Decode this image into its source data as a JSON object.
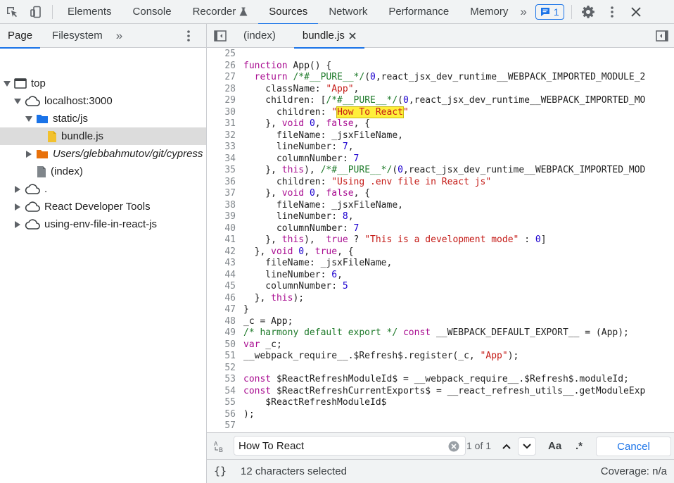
{
  "toolbar": {
    "tabs": [
      "Elements",
      "Console",
      "Recorder",
      "Sources",
      "Network",
      "Performance",
      "Memory"
    ],
    "more": "»",
    "issues_count": "1"
  },
  "navigator": {
    "tabs": [
      "Page",
      "Filesystem"
    ],
    "more": "»",
    "tree": [
      {
        "label": "top"
      },
      {
        "label": "localhost:3000"
      },
      {
        "label": "static/js"
      },
      {
        "label": "bundle.js"
      },
      {
        "label": "Users/glebbahmutov/git/cypress"
      },
      {
        "label": "(index)"
      },
      {
        "label": "."
      },
      {
        "label": "React Developer Tools"
      },
      {
        "label": "using-env-file-in-react-js"
      }
    ]
  },
  "editor": {
    "tabs": [
      "(index)",
      "bundle.js"
    ]
  },
  "find": {
    "query": "How To React",
    "count": "1 of 1",
    "match_case_label": "Aa",
    "regex_label": ".*",
    "cancel_label": "Cancel"
  },
  "status": {
    "braces_label": "{}",
    "selection": "12 characters selected",
    "coverage": "Coverage: n/a"
  }
}
